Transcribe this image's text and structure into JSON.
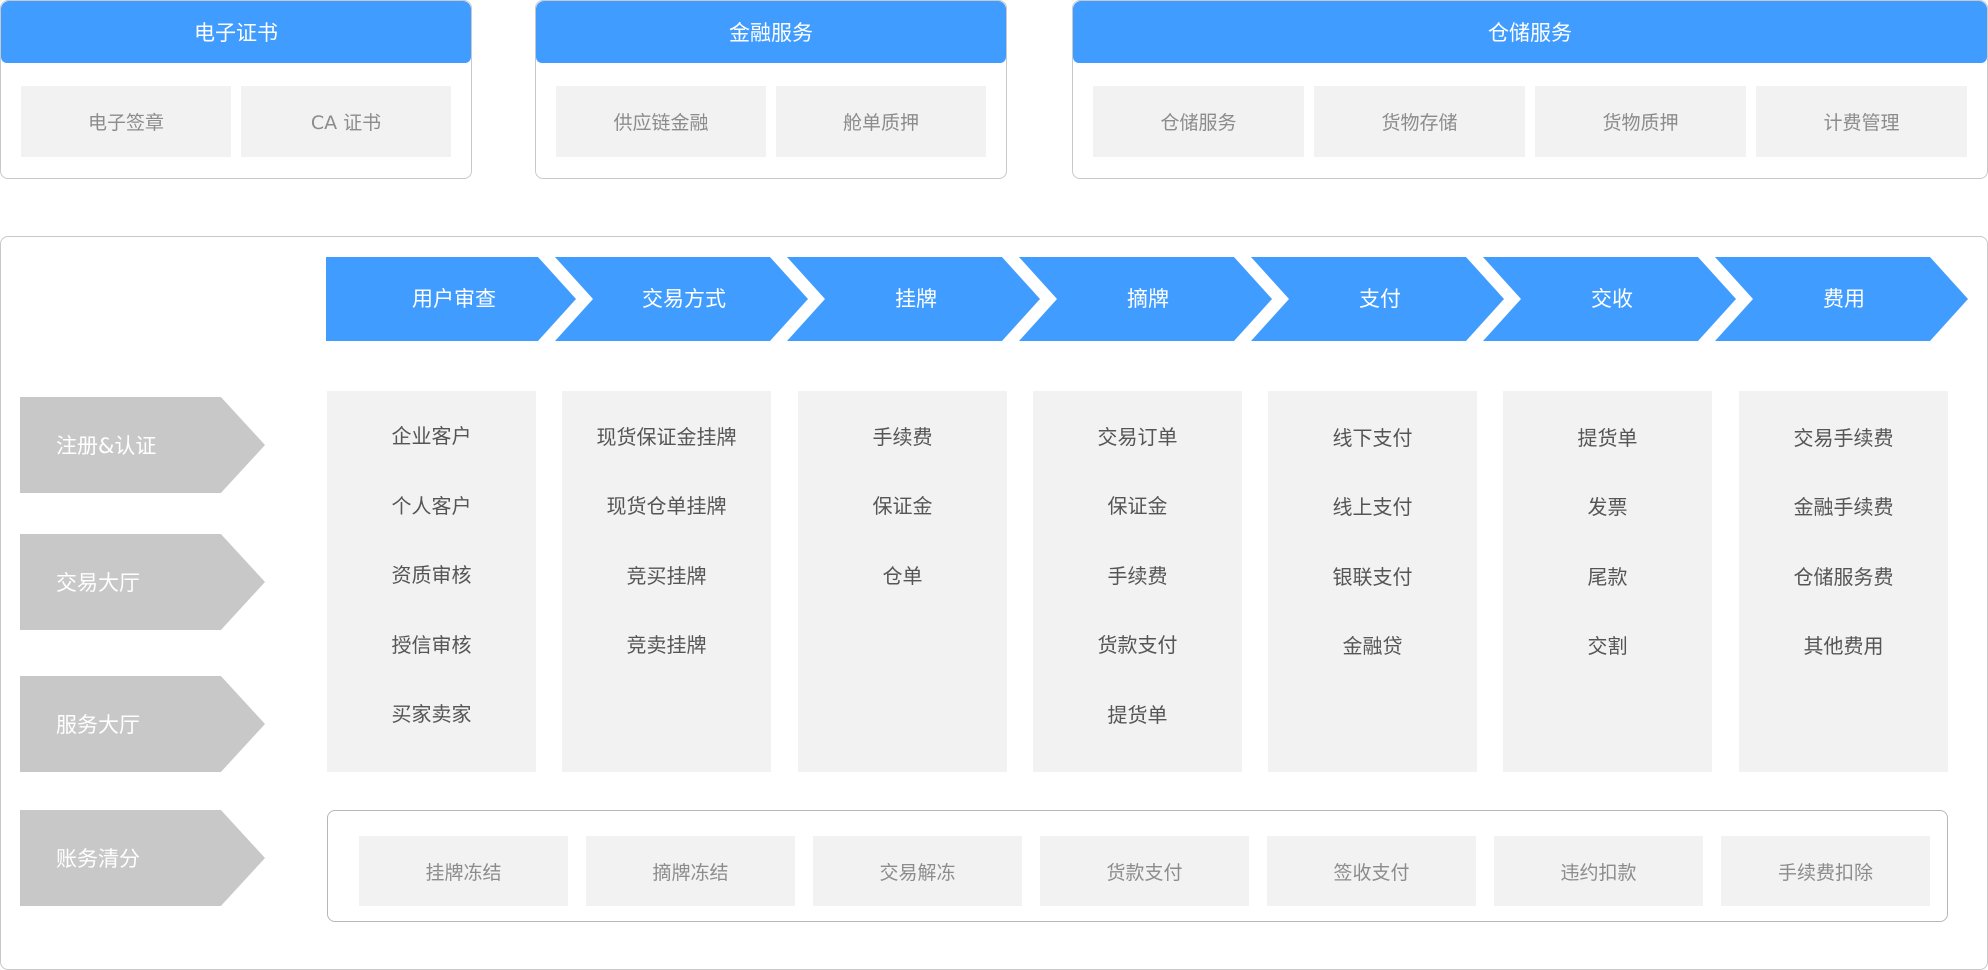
{
  "services": [
    {
      "title": "电子证书",
      "items": [
        "电子签章",
        "CA 证书"
      ]
    },
    {
      "title": "金融服务",
      "items": [
        "供应链金融",
        "舱单质押"
      ]
    },
    {
      "title": "仓储服务",
      "items": [
        "仓储服务",
        "货物存储",
        "货物质押",
        "计费管理"
      ]
    }
  ],
  "flow_steps": [
    "用户审查",
    "交易方式",
    "挂牌",
    "摘牌",
    "支付",
    "交收",
    "费用"
  ],
  "side_labels": [
    "注册&认证",
    "交易大厅",
    "服务大厅",
    "账务清分"
  ],
  "columns": [
    [
      "企业客户",
      "个人客户",
      "资质审核",
      "授信审核",
      "买家卖家"
    ],
    [
      "现货保证金挂牌",
      "现货仓单挂牌",
      "竞买挂牌",
      "竞卖挂牌"
    ],
    [
      "手续费",
      "保证金",
      "仓单"
    ],
    [
      "交易订单",
      "保证金",
      "手续费",
      "货款支付",
      "提货单"
    ],
    [
      "线下支付",
      "线上支付",
      "银联支付",
      "金融贷"
    ],
    [
      "提货单",
      "发票",
      "尾款",
      "交割"
    ],
    [
      "交易手续费",
      "金融手续费",
      "仓储服务费",
      "其他费用"
    ]
  ],
  "settlement_items": [
    "挂牌冻结",
    "摘牌冻结",
    "交易解冻",
    "货款支付",
    "签收支付",
    "违约扣款",
    "手续费扣除"
  ],
  "colors": {
    "accent": "#419cff",
    "side_arrow": "#c8c8c8",
    "panel_bg": "#f2f2f2"
  }
}
